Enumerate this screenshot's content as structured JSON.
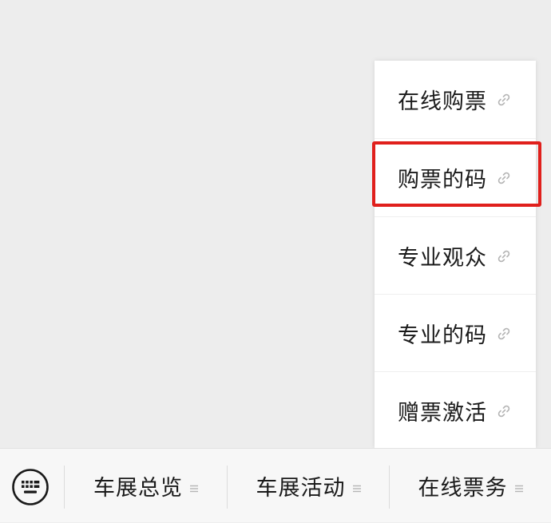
{
  "popup_menu": {
    "items": [
      {
        "label": "在线购票",
        "icon": "link-icon"
      },
      {
        "label": "购票的码",
        "icon": "link-icon"
      },
      {
        "label": "专业观众",
        "icon": "link-icon"
      },
      {
        "label": "专业的码",
        "icon": "link-icon"
      },
      {
        "label": "赠票激活",
        "icon": "link-icon"
      }
    ],
    "highlighted_index": 1
  },
  "bottom_bar": {
    "keyboard_icon": "keyboard-icon",
    "menus": [
      {
        "label": "车展总览",
        "icon": "menu-icon"
      },
      {
        "label": "车展活动",
        "icon": "menu-icon"
      },
      {
        "label": "在线票务",
        "icon": "menu-icon"
      }
    ]
  },
  "colors": {
    "background": "#ededed",
    "popup_background": "#ffffff",
    "highlight": "#e0201c",
    "text": "#1a1a1a",
    "icon": "#b5b5b5"
  }
}
